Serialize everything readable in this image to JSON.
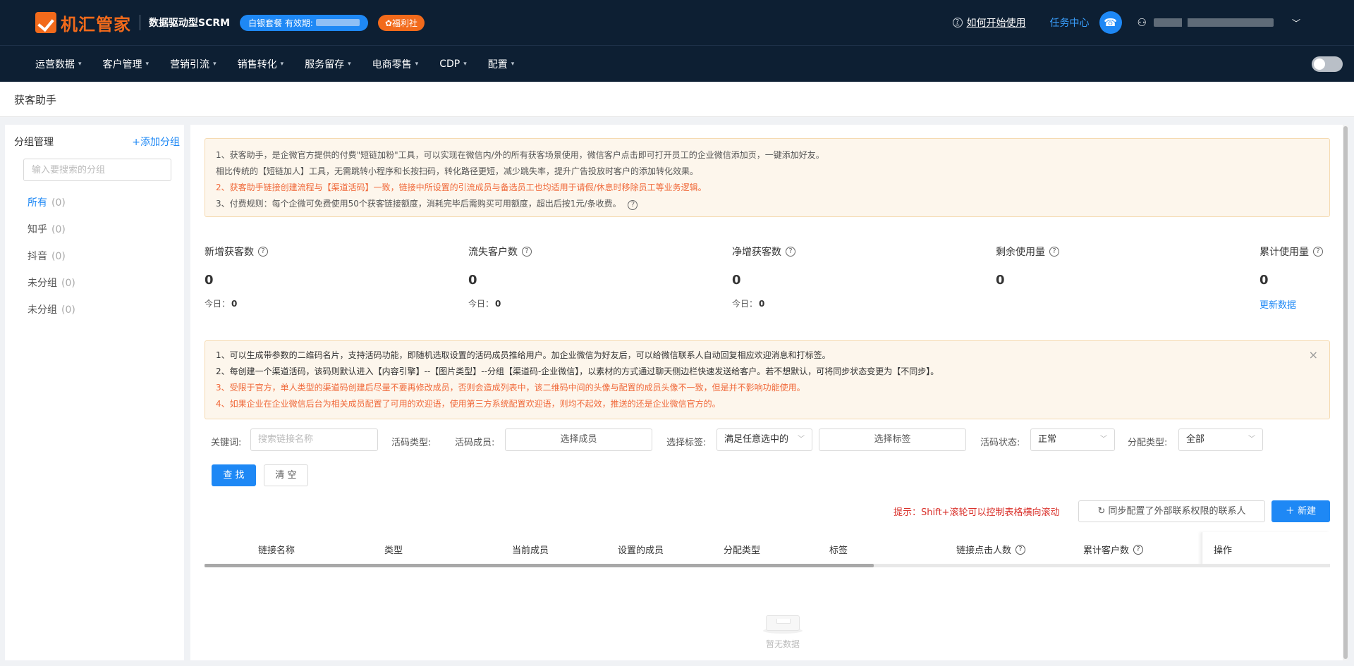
{
  "header": {
    "brand": "机汇管家",
    "product": "数据驱动型SCRM",
    "plan_label": "白银套餐 有效期:",
    "welfare_label": "✿福利社",
    "help_link": "如何开始使用",
    "task_center": "任务中心"
  },
  "nav": {
    "items": [
      "运营数据",
      "客户管理",
      "营销引流",
      "销售转化",
      "服务留存",
      "电商零售",
      "CDP",
      "配置"
    ]
  },
  "page": {
    "title": "获客助手"
  },
  "sidebar": {
    "title": "分组管理",
    "add_label": "+添加分组",
    "search_placeholder": "输入要搜索的分组",
    "groups": [
      {
        "name": "所有",
        "count": "(0)"
      },
      {
        "name": "知乎",
        "count": "(0)"
      },
      {
        "name": "抖音",
        "count": "(0)"
      },
      {
        "name": "未分组",
        "count": "(0)"
      },
      {
        "name": "未分组",
        "count": "(0)"
      }
    ]
  },
  "intro_tip": {
    "line1": "1、获客助手，是企微官方提供的付费\"短链加粉\"工具，可以实现在微信内/外的所有获客场景使用，微信客户点击即可打开员工的企业微信添加页，一键添加好友。",
    "line2": "相比传统的【短链加人】工具，无需跳转小程序和长按扫码，转化路径更短，减少跳失率，提升广告投放时客户的添加转化效果。",
    "line3": "2、获客助手链接创建流程与【渠道活码】一致，链接中所设置的引流成员与备选员工也均适用于请假/休息时移除员工等业务逻辑。",
    "line4": "3、付费规则：每个企微可免费使用50个获客链接额度，消耗完毕后需购买可用额度，超出后按1元/条收费。"
  },
  "stats": {
    "new_label": "新增获客数",
    "new_value": "0",
    "new_today_label": "今日：",
    "new_today": "0",
    "lost_label": "流失客户数",
    "lost_value": "0",
    "lost_today_label": "今日：",
    "lost_today": "0",
    "net_label": "净增获客数",
    "net_value": "0",
    "net_today_label": "今日：",
    "net_today": "0",
    "remain_label": "剩余使用量",
    "remain_value": "0",
    "total_label": "累计使用量",
    "total_value": "0",
    "update_link": "更新数据"
  },
  "notice_tip": {
    "line1": "1、可以生成带参数的二维码名片，支持活码功能，即随机选取设置的活码成员推给用户。加企业微信为好友后，可以给微信联系人自动回复相应欢迎消息和打标签。",
    "line2": "2、每创建一个渠道活码，该码则默认进入【内容引擎】--【图片类型】--分组【渠道码-企业微信】，以素材的方式通过聊天侧边栏快速发送给客户。若不想默认，可将同步状态变更为【不同步】。",
    "line3": "3、受限于官方，单人类型的渠道码创建后尽量不要再修改成员，否则会造成列表中，该二维码中间的头像与配置的成员头像不一致，但是并不影响功能使用。",
    "line4": "4、如果企业在企业微信后台为相关成员配置了可用的欢迎语，使用第三方系统配置欢迎语，则均不起效，推送的还是企业微信官方的。",
    "close": "×"
  },
  "filters": {
    "keyword_label": "关键词:",
    "keyword_placeholder": "搜索链接名称",
    "type_label": "活码类型:",
    "member_label": "活码成员:",
    "member_button": "选择成员",
    "tag_label": "选择标签:",
    "tag_mode": "满足任意选中的",
    "tag_button": "选择标签",
    "status_label": "活码状态:",
    "status_value": "正常",
    "assign_label": "分配类型:",
    "assign_value": "全部",
    "search_button": "查 找",
    "clear_button": "清 空"
  },
  "toolbar": {
    "hint": "提示：Shift+滚轮可以控制表格横向滚动",
    "sync_button": "同步配置了外部联系权限的联系人",
    "new_button": "新建"
  },
  "table": {
    "columns": [
      "链接名称",
      "类型",
      "当前成员",
      "设置的成员",
      "分配类型",
      "标签",
      "链接点击人数",
      "累计客户数",
      "操作"
    ],
    "empty_text": "暂无数据"
  }
}
